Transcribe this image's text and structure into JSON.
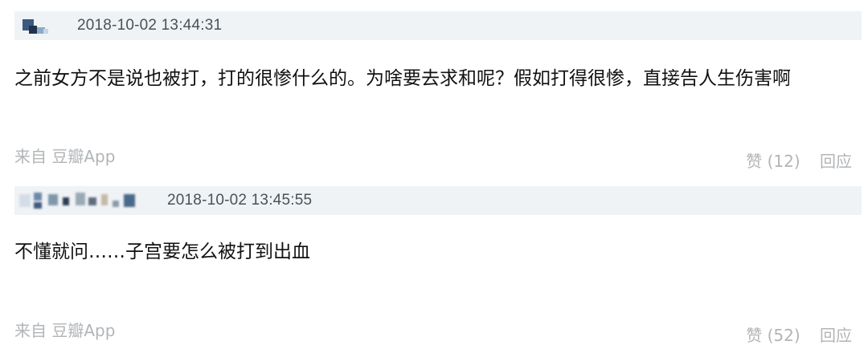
{
  "comments": [
    {
      "timestamp": "2018-10-02 13:44:31",
      "body": "之前女方不是说也被打，打的很惨什么的。为啥要去求和呢？假如打得很惨，直接告人生伤害啊",
      "source": "来自 豆瓣App",
      "like_label": "赞 (12)",
      "reply_label": "回应"
    },
    {
      "timestamp": "2018-10-02 13:45:55",
      "body": "不懂就问……子宫要怎么被打到出血",
      "source": "来自 豆瓣App",
      "like_label": "赞 (52)",
      "reply_label": "回应"
    }
  ],
  "colors": {
    "header_bg": "#f0f3f5",
    "text": "#111111",
    "meta": "#b1b5b8",
    "timestamp": "#4a5257"
  },
  "icons": {
    "avatar": "pixelated-avatar-icon",
    "username": "blurred-username"
  }
}
